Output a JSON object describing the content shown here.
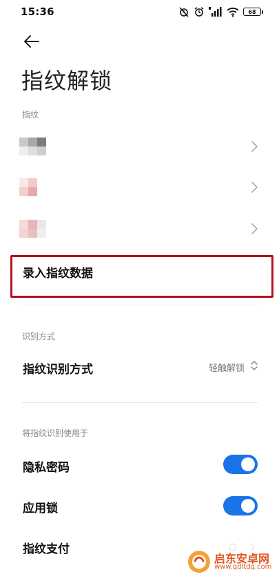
{
  "status": {
    "time": "15:36",
    "battery": "68",
    "icons": [
      "alarm-off-icon",
      "alarm-icon",
      "hd-signal-icon",
      "wifi-icon",
      "battery-icon"
    ]
  },
  "header": {
    "title": "指纹解锁",
    "back_icon": "back-arrow-icon"
  },
  "fingerprints": {
    "section_label": "指纹",
    "items": [
      {
        "colors": [
          "#c9c9c9",
          "#a9a9a9",
          "#7c7c7c",
          "#efefef",
          "#dedede",
          "#cfcfcf"
        ]
      },
      {
        "colors": [
          "#fbe7e7",
          "#f3c9c9",
          "#ffffff",
          "#f2cfcf",
          "#e9a9a9",
          "#ffffff"
        ]
      },
      {
        "colors": [
          "#f7dada",
          "#e7b7b7",
          "#e8e8e8",
          "#f3d3d3",
          "#e8c0c0",
          "#efefef"
        ]
      }
    ],
    "enroll_label": "录入指纹数据",
    "accent": "#b5121b"
  },
  "recognition": {
    "section_label": "识别方式",
    "mode_label": "指纹识别方式",
    "mode_value": "轻触解锁"
  },
  "usage": {
    "section_label": "将指纹识别使用于",
    "items": [
      {
        "label": "隐私密码",
        "toggle_on": true
      },
      {
        "label": "应用锁",
        "toggle_on": true
      },
      {
        "label": "指纹支付"
      }
    ],
    "toggle_color": "#1a73e8"
  },
  "watermark": {
    "name": "启东安卓网",
    "url": "www.qdltdq.com"
  }
}
